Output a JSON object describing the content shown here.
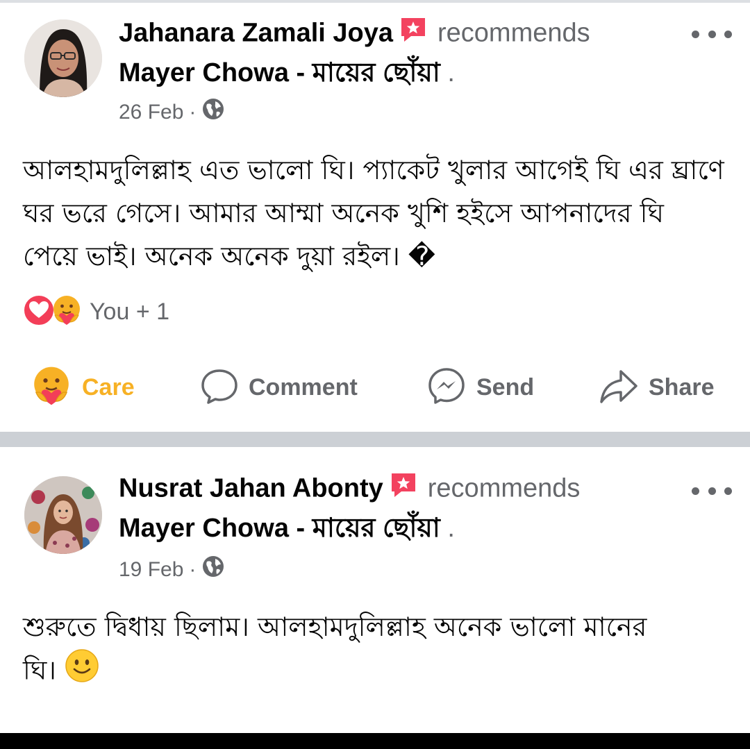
{
  "posts": [
    {
      "author": "Jahanara Zamali Joya",
      "recommends_label": "recommends",
      "page_name": "Mayer Chowa - মায়ের ছোঁয়া",
      "page_suffix": ".",
      "date": "26 Feb",
      "meta_separator": "·",
      "privacy_icon": "globe-icon",
      "text": "আলহামদুলিল্লাহ এত ভালো ঘি। প্যাকেট খুলার আগেই ঘি এর ঘ্রাণে ঘর ভরে গেসে। আমার আম্মা অনেক খুশি হইসে আপনাদের ঘি পেয়ে ভাই। অনেক অনেক দুয়া রইল। �",
      "reactions": {
        "icons": [
          "love-icon",
          "care-icon"
        ],
        "count_label": "You + 1"
      },
      "actions": [
        {
          "label": "Care",
          "icon": "care-icon"
        },
        {
          "label": "Comment",
          "icon": "comment-icon"
        },
        {
          "label": "Send",
          "icon": "messenger-icon"
        },
        {
          "label": "Share",
          "icon": "share-icon"
        }
      ]
    },
    {
      "author": "Nusrat Jahan Abonty",
      "recommends_label": "recommends",
      "page_name": "Mayer Chowa - মায়ের ছোঁয়া",
      "page_suffix": ".",
      "date": "19 Feb",
      "meta_separator": "·",
      "privacy_icon": "globe-icon",
      "text": "শুরুতে দ্বিধায় ছিলাম। আলহামদুলিল্লাহ অনেক ভালো মানের ঘি।",
      "text_emoji": "slightly-smiling-face-icon"
    }
  ],
  "colors": {
    "recommend_badge": "#f3425f",
    "care_label": "#f7b125",
    "secondary_text": "#65676b",
    "separator": "#ccd0d5"
  }
}
